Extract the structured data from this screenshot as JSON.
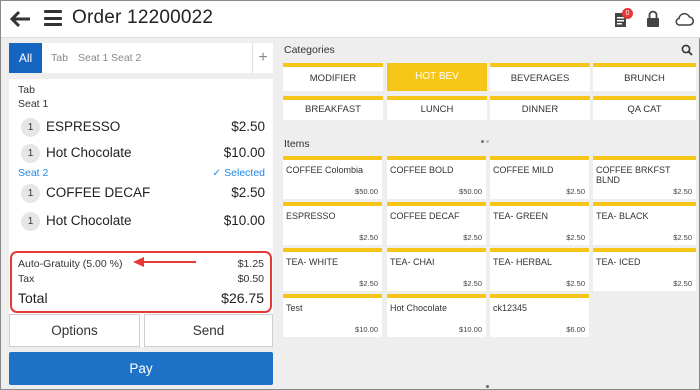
{
  "header": {
    "title": "Order 12200022",
    "badge_count": "0"
  },
  "tabs": {
    "all": "All",
    "tab": "Tab",
    "seat1": "Seat 1",
    "seat2": "Seat 2",
    "add": "+"
  },
  "order": {
    "tab_label": "Tab",
    "seat1_label": "Seat 1",
    "seat2_label": "Seat 2",
    "selected_label": "✓  Selected",
    "items": [
      {
        "qty": "1",
        "name": "ESPRESSO",
        "price": "$2.50"
      },
      {
        "qty": "1",
        "name": "Hot Chocolate",
        "price": "$10.00"
      },
      {
        "qty": "1",
        "name": "COFFEE DECAF",
        "price": "$2.50"
      },
      {
        "qty": "1",
        "name": "Hot Chocolate",
        "price": "$10.00"
      }
    ],
    "gratuity_label": "Auto-Gratuity (5.00 %)",
    "gratuity_value": "$1.25",
    "tax_label": "Tax",
    "tax_value": "$0.50",
    "total_label": "Total",
    "total_value": "$26.75"
  },
  "buttons": {
    "options": "Options",
    "send": "Send",
    "pay": "Pay"
  },
  "categories_label": "Categories",
  "categories": [
    "MODIFIER",
    "HOT BEV",
    "BEVERAGES",
    "BRUNCH",
    "BREAKFAST",
    "LUNCH",
    "DINNER",
    "QA CAT"
  ],
  "items_label": "Items",
  "products": [
    {
      "name": "COFFEE Colombia",
      "price": "$50.00"
    },
    {
      "name": "COFFEE BOLD",
      "price": "$50.00"
    },
    {
      "name": "COFFEE MILD",
      "price": "$2.50"
    },
    {
      "name": "COFFEE BRKFST BLND",
      "price": "$2.50"
    },
    {
      "name": "ESPRESSO",
      "price": "$2.50"
    },
    {
      "name": "COFFEE DECAF",
      "price": "$2.50"
    },
    {
      "name": "TEA- GREEN",
      "price": "$2.50"
    },
    {
      "name": "TEA- BLACK",
      "price": "$2.50"
    },
    {
      "name": "TEA- WHITE",
      "price": "$2.50"
    },
    {
      "name": "TEA- CHAI",
      "price": "$2.50"
    },
    {
      "name": "TEA- HERBAL",
      "price": "$2.50"
    },
    {
      "name": "TEA- ICED",
      "price": "$2.50"
    },
    {
      "name": "Test",
      "price": "$10.00"
    },
    {
      "name": "Hot Chocolate",
      "price": "$10.00"
    },
    {
      "name": "ck12345",
      "price": "$6.00"
    }
  ],
  "colors": {
    "accent": "#f5c518",
    "primary": "#1e73c8",
    "highlight": "#e53935",
    "link": "#1e88e5"
  },
  "icons": [
    "back-arrow-icon",
    "menu-icon",
    "ticket-icon",
    "lock-icon",
    "cloud-icon",
    "search-icon"
  ]
}
